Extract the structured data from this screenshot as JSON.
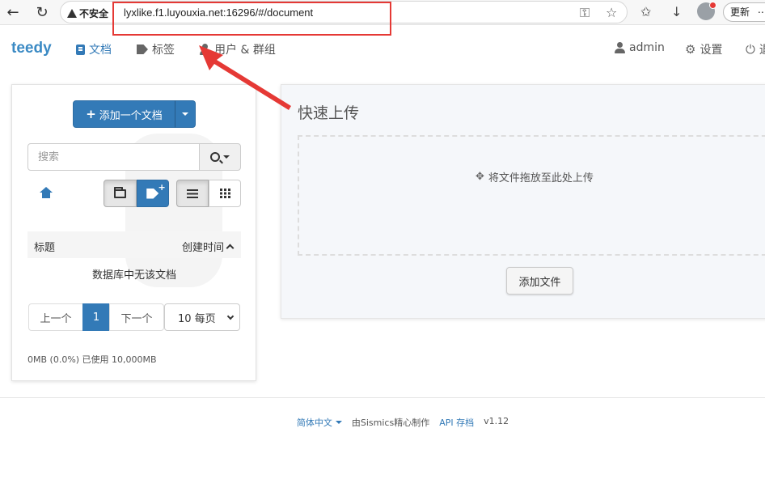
{
  "browser": {
    "insecure_label": "不安全",
    "url": "lyxlike.f1.luyouxia.net:16296/#/document",
    "update_label": "更新",
    "more_label": "⋯"
  },
  "navbar": {
    "brand": "teedy",
    "documents": "文档",
    "tags": "标签",
    "users_groups": "用户 & 群组",
    "user": "admin",
    "settings": "设置",
    "logout": "退"
  },
  "sidebar": {
    "add_document": "添加一个文档",
    "search_placeholder": "搜索",
    "column_title": "标题",
    "column_created": "创建时间",
    "empty_message": "数据库中无该文档",
    "pagination": {
      "prev": "上一个",
      "current": "1",
      "next": "下一个"
    },
    "per_page": "10 每页",
    "quota": "0MB (0.0%) 已使用 10,000MB"
  },
  "quick_upload": {
    "title": "快速上传",
    "drop_hint": "将文件拖放至此处上传",
    "add_file": "添加文件"
  },
  "footer": {
    "language": "简体中文",
    "credit": "由Sismics精心制作",
    "api": "API 存档",
    "version": "v1.12"
  },
  "colors": {
    "primary": "#337ab7",
    "brand": "#3b8ac4",
    "annotation": "#e53935"
  }
}
